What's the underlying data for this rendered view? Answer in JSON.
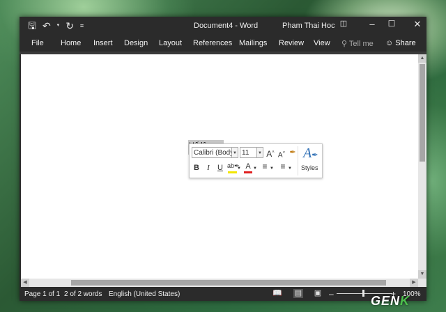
{
  "titlebar": {
    "doc_title": "Document4 - Word",
    "user_name": "Pham Thai Hoc",
    "qat": {
      "save_icon": "save-icon",
      "undo_icon": "undo-icon",
      "redo_icon": "redo-icon",
      "customize_icon": "customize-icon"
    },
    "window_controls": [
      "ribbon-display-options-icon",
      "minimize-icon",
      "maximize-icon",
      "close-icon"
    ]
  },
  "ribbon": {
    "tabs": [
      "File",
      "Home",
      "Insert",
      "Design",
      "Layout",
      "References",
      "Mailings",
      "Review",
      "View"
    ],
    "tell_me": "Tell me",
    "share": "Share"
  },
  "document": {
    "text": "Hế lô...."
  },
  "mini_toolbar": {
    "font_name": "Calibri (Body)",
    "font_size": "11",
    "styles_label": "Styles",
    "buttons": [
      "grow-font-icon",
      "shrink-font-icon",
      "format-painter-icon",
      "bold-icon",
      "italic-icon",
      "underline-icon",
      "highlight-icon",
      "font-color-icon",
      "bullets-icon",
      "numbering-icon",
      "styles-icon"
    ],
    "highlight_color": "#f2e600",
    "font_color": "#e02020"
  },
  "statusbar": {
    "page": "Page 1 of 1",
    "words": "2 of 2 words",
    "language": "English (United States)",
    "zoom": "100%"
  },
  "watermark": "GENK",
  "colors": {
    "chrome": "#2b2b2b",
    "selection": "#c6c6c6",
    "accent": "#2e6fb5"
  }
}
